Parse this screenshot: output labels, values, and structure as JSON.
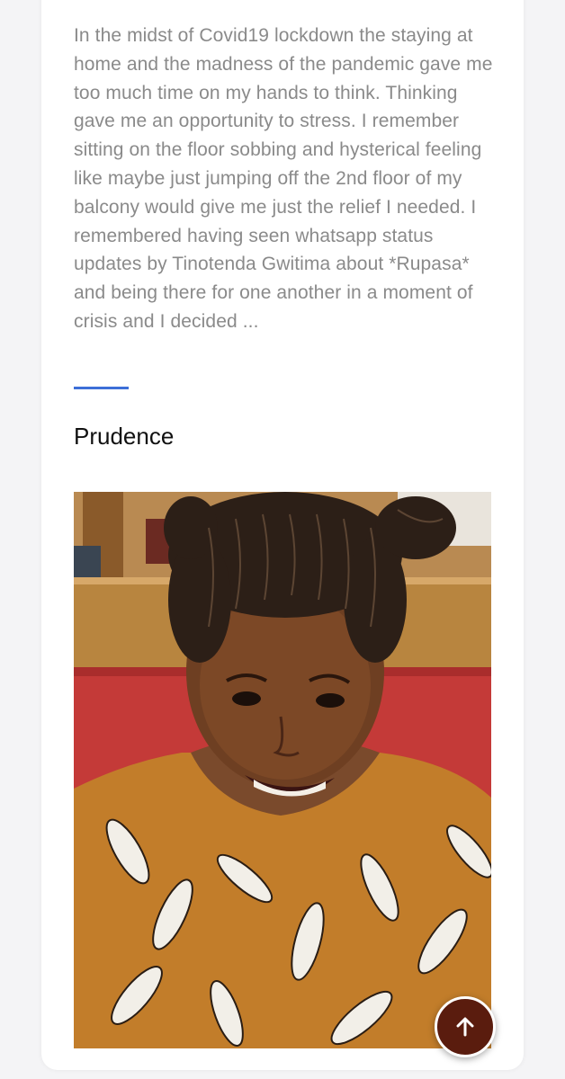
{
  "post": {
    "excerpt": "In the midst of Covid19 lockdown the staying at home and the madness of the pandemic gave me too much time on my hands to think. Thinking gave me an opportunity to stress. I remember sitting on the floor sobbing and hysterical feeling like maybe just jumping off the 2nd floor of my balcony would give me just the relief I needed. I remembered having seen whatsapp status updates by Tinotenda Gwitima about *Rupasa* and being there for one another in a moment of crisis and I decided ...",
    "author": "Prudence"
  },
  "colors": {
    "divider": "#3d6fd8",
    "scroll_button": "#5a1c0e",
    "excerpt_text": "#8a8a8a"
  },
  "icons": {
    "scroll_top": "arrow-up-icon"
  }
}
